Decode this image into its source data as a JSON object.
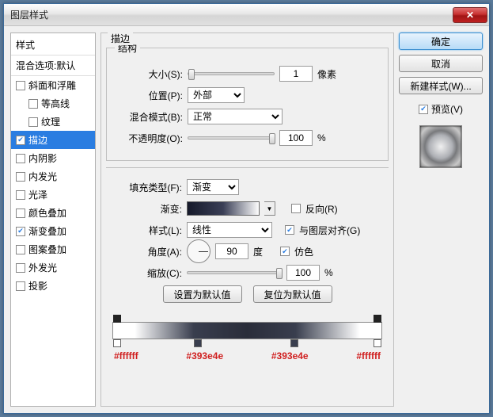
{
  "window": {
    "title": "图层样式"
  },
  "sidebar": {
    "header": "样式",
    "blend": "混合选项:默认",
    "items": [
      {
        "label": "斜面和浮雕",
        "checked": false,
        "indent": false
      },
      {
        "label": "等高线",
        "checked": false,
        "indent": true
      },
      {
        "label": "纹理",
        "checked": false,
        "indent": true
      },
      {
        "label": "描边",
        "checked": true,
        "indent": false,
        "selected": true
      },
      {
        "label": "内阴影",
        "checked": false,
        "indent": false
      },
      {
        "label": "内发光",
        "checked": false,
        "indent": false
      },
      {
        "label": "光泽",
        "checked": false,
        "indent": false
      },
      {
        "label": "颜色叠加",
        "checked": false,
        "indent": false
      },
      {
        "label": "渐变叠加",
        "checked": true,
        "indent": false
      },
      {
        "label": "图案叠加",
        "checked": false,
        "indent": false
      },
      {
        "label": "外发光",
        "checked": false,
        "indent": false
      },
      {
        "label": "投影",
        "checked": false,
        "indent": false
      }
    ]
  },
  "main": {
    "title": "描边",
    "struct": {
      "legend": "结构",
      "size_label": "大小(S):",
      "size_value": "1",
      "size_unit": "像素",
      "position_label": "位置(P):",
      "position_value": "外部",
      "blend_label": "混合模式(B):",
      "blend_value": "正常",
      "opacity_label": "不透明度(O):",
      "opacity_value": "100",
      "opacity_unit": "%"
    },
    "fill": {
      "type_label": "填充类型(F):",
      "type_value": "渐变",
      "grad_label": "渐变:",
      "reverse_label": "反向(R)",
      "style_label": "样式(L):",
      "style_value": "线性",
      "align_label": "与图层对齐(G)",
      "align_checked": true,
      "angle_label": "角度(A):",
      "angle_value": "90",
      "angle_unit": "度",
      "dither_label": "仿色",
      "dither_checked": true,
      "scale_label": "缩放(C):",
      "scale_value": "100",
      "scale_unit": "%",
      "default_btn": "设置为默认值",
      "reset_btn": "复位为默认值"
    },
    "stops": {
      "s1": "#ffffff",
      "s2": "#393e4e",
      "s3": "#393e4e",
      "s4": "#ffffff"
    }
  },
  "right": {
    "ok": "确定",
    "cancel": "取消",
    "new_style": "新建样式(W)...",
    "preview_label": "预览(V)",
    "preview_checked": true
  }
}
